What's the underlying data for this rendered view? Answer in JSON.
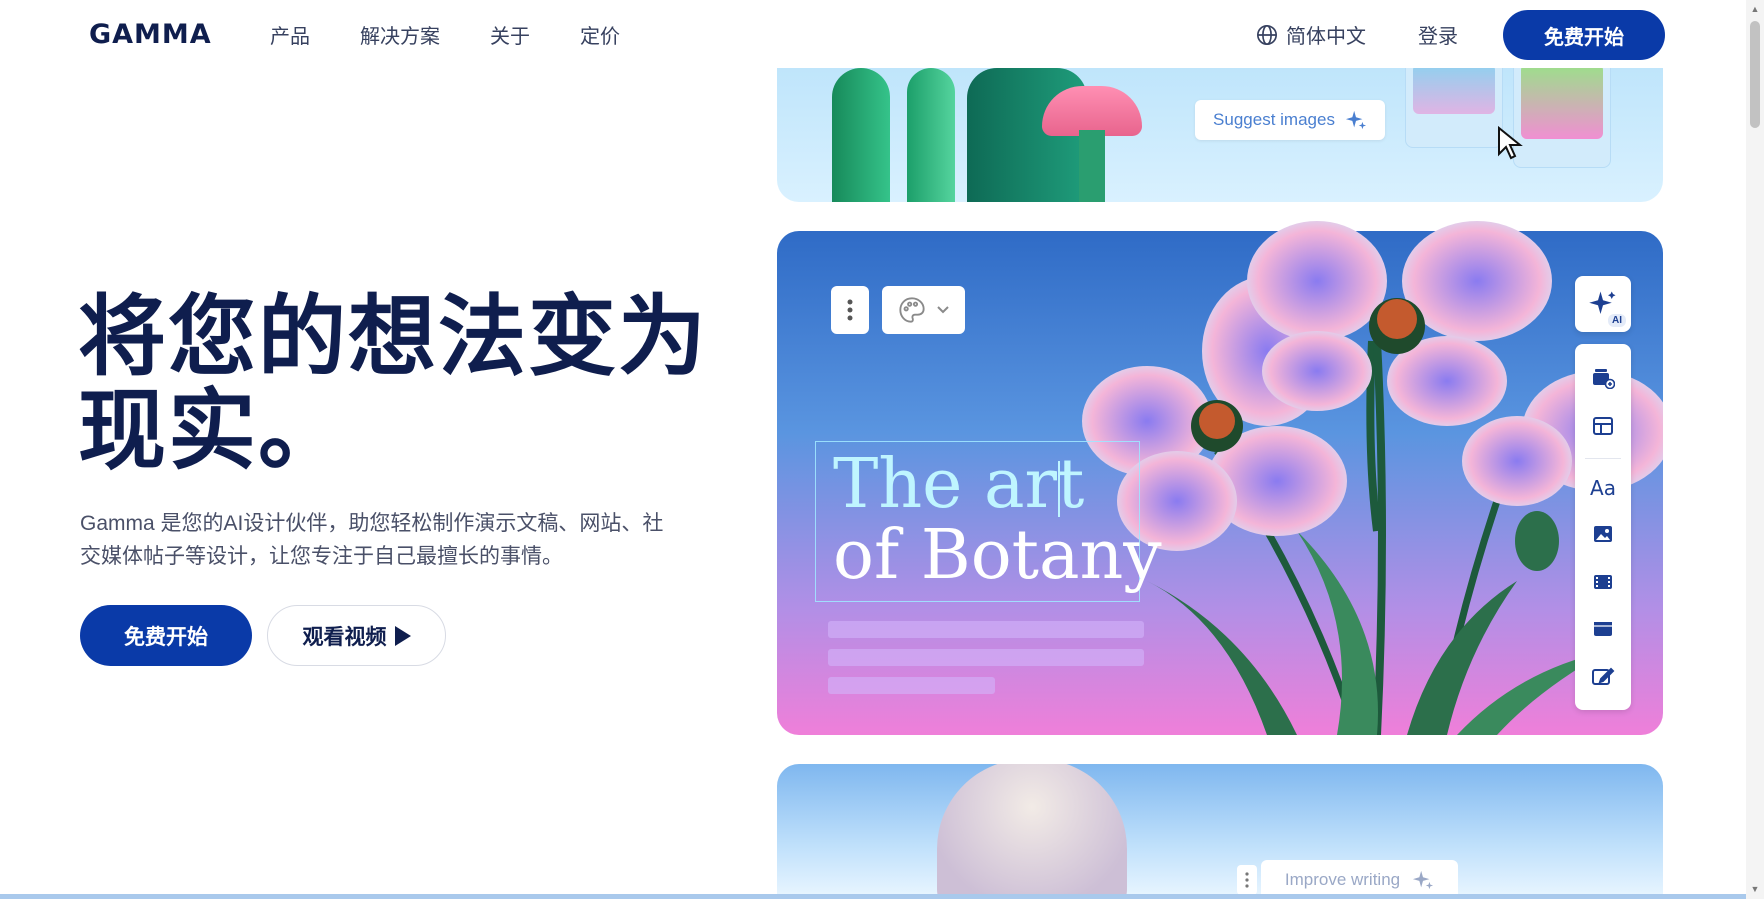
{
  "nav": {
    "logo": "GAMMA",
    "links": [
      "产品",
      "解决方案",
      "关于",
      "定价"
    ],
    "language": "简体中文",
    "login": "登录",
    "cta": "免费开始"
  },
  "hero": {
    "title_line1": "将您的想法变为",
    "title_line2": "现实。",
    "subtitle_line1": "Gamma 是您的AI设计伙伴，助您轻松制作演示文稿、网站、社",
    "subtitle_line2": "交媒体帖子等设计，让您专注于自己最擅长的事情。",
    "start_button": "免费开始",
    "video_button": "观看视频"
  },
  "cards": {
    "top": {
      "suggest_label": "Suggest images"
    },
    "main": {
      "title_line1": "The art",
      "title_line2": "of Botany",
      "ai_tag": "AI",
      "sidebar_icons": [
        "add-card-icon",
        "layout-icon",
        "text-icon",
        "image-icon",
        "video-icon",
        "embed-icon",
        "edit-icon"
      ]
    },
    "bottom": {
      "improve_label": "Improve writing"
    }
  },
  "colors": {
    "brand_navy": "#0f1e4e",
    "cta_blue": "#0a3aa8",
    "text_gray": "#4a5068"
  }
}
